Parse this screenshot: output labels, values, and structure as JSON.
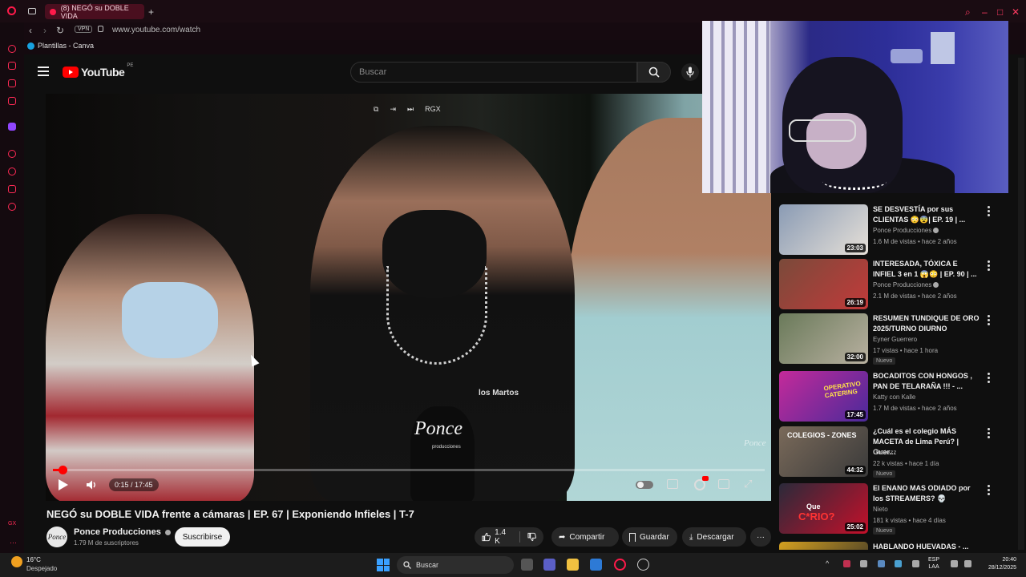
{
  "browser": {
    "tab_title": "(8) NEGÓ su DOBLE VIDA",
    "url": "www.youtube.com/watch",
    "vpn_label": "VPN",
    "bookmark": "Plantillas - Canva"
  },
  "youtube": {
    "logo_text": "YouTube",
    "country_code": "PE",
    "search_placeholder": "Buscar"
  },
  "player": {
    "time": "0:15 / 17:45",
    "progress_fraction": 0.014,
    "overlay_label": "RGX",
    "watermark": "Ponce",
    "mic_brand": "Ponce",
    "mic_brand_sub": "producciones",
    "shirt_text": "los Martos"
  },
  "video": {
    "title": "NEGÓ su DOBLE VIDA frente a cámaras | EP. 67 | Exponiendo Infieles | T-7",
    "channel": "Ponce Producciones",
    "subscribers": "1.79 M de suscriptores",
    "subscribe_label": "Suscribirse",
    "likes": "1.4 K",
    "share_label": "Compartir",
    "save_label": "Guardar",
    "download_label": "Descargar"
  },
  "recommendations": [
    {
      "title": "SE DESVESTÍA por sus CLIENTAS 😳😨| EP. 19 | ...",
      "channel": "Ponce Producciones",
      "verified": true,
      "meta": "1.6 M de vistas • hace 2 años",
      "duration": "23:03",
      "badge": "",
      "colors": [
        "#8a9bb4",
        "#e6e0d8"
      ]
    },
    {
      "title": "INTERESADA, TÓXICA E INFIEL 3 en 1 😱😳 | EP. 90 | ...",
      "channel": "Ponce Producciones",
      "verified": true,
      "meta": "2.1 M de vistas • hace 2 años",
      "duration": "26:19",
      "badge": "",
      "colors": [
        "#7a4a3a",
        "#c23a3a"
      ]
    },
    {
      "title": "RESUMEN TUNDIQUE DE ORO 2025/TURNO DIURNO",
      "channel": "Eyner Guerrero",
      "verified": false,
      "meta": "17 vistas • hace 1 hora",
      "duration": "32:00",
      "badge": "Nuevo",
      "colors": [
        "#6a7a5a",
        "#b8b0a0"
      ]
    },
    {
      "title": "BOCADITOS CON HONGOS , PAN DE TELARAÑA !!! - ...",
      "channel": "Katty con Kalle",
      "verified": false,
      "meta": "1.7 M de vistas • hace 2 años",
      "duration": "17:45",
      "badge": "",
      "colors": [
        "#c42a9a",
        "#4a2a9a"
      ]
    },
    {
      "title": "¿Cuál es el colegio MÁS MACETA de Lima Perú? | Guer...",
      "channel": "Chetezz",
      "verified": false,
      "meta": "22 k vistas • hace 1 día",
      "duration": "44:32",
      "badge": "Nuevo",
      "colors": [
        "#7a6a5a",
        "#3a3a3a"
      ]
    },
    {
      "title": "El ENANO MAS ODIADO por los STREAMERS? 💀",
      "channel": "Nieto",
      "verified": false,
      "meta": "181 k vistas • hace 4 días",
      "duration": "25:02",
      "badge": "Nuevo",
      "colors": [
        "#2a2a3a",
        "#c4102a"
      ]
    },
    {
      "title": "HABLANDO HUEVADAS - ...",
      "channel": "",
      "verified": false,
      "meta": "",
      "duration": "",
      "badge": "",
      "colors": [
        "#d4a020",
        "#2a2a2a"
      ]
    }
  ],
  "thumb_text": {
    "t4": "OPERATIVO CATERING",
    "t5": "COLEGIOS - ZONES",
    "t6": "C*RIO?",
    "t6_top": "Que"
  },
  "taskbar": {
    "temperature": "16°C",
    "weather": "Despejado",
    "search": "Buscar",
    "lang_top": "ESP",
    "lang_bottom": "LAA",
    "time": "20:40",
    "date": "28/12/2025"
  },
  "icons": {
    "opera": "opera-icon",
    "back": "back-arrow-icon",
    "forward": "forward-arrow-icon",
    "reload": "reload-icon",
    "lock": "lock-icon",
    "menu": "hamburger-icon",
    "search": "search-icon",
    "mic": "microphone-icon"
  },
  "colors": {
    "accent": "#ff0000",
    "opera_red": "#ff1a4a",
    "background": "#0f0f0f"
  }
}
